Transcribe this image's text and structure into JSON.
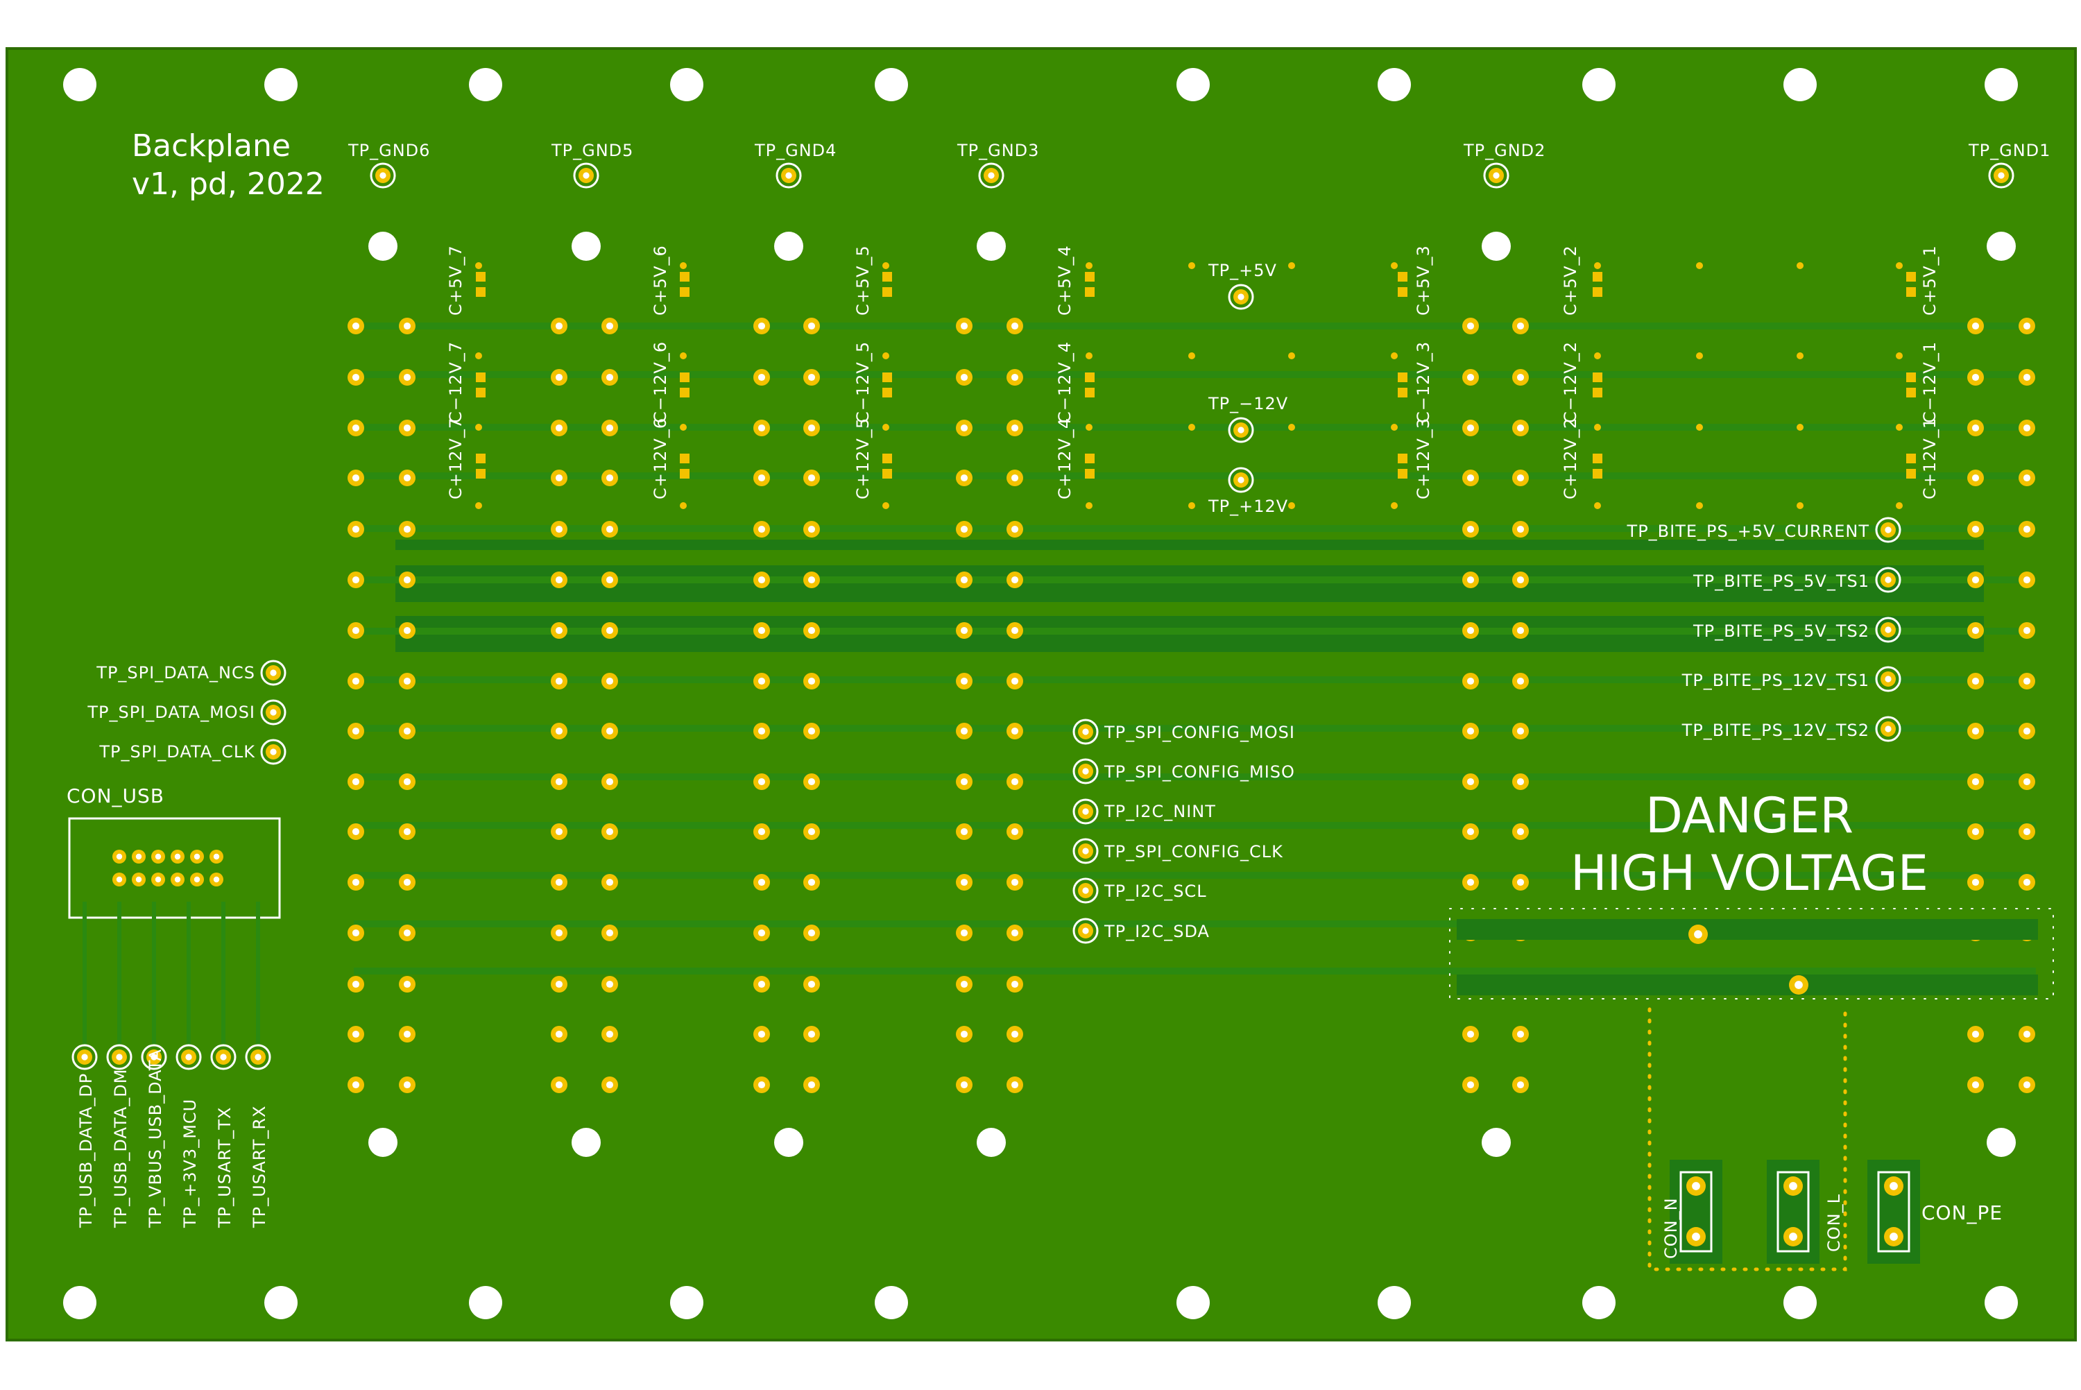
{
  "board": {
    "title_line1": "Backplane",
    "title_line2": "v1, pd, 2022",
    "colors": {
      "board": "#3a8a00",
      "board_edge": "#2d6e00",
      "copper_pour": "#1f7a14",
      "trace": "#2b8a10",
      "pad_gold": "#f2c200",
      "drill": "#ffffff",
      "silkscreen": "#ffffff"
    }
  },
  "gnd_testpoints": [
    "TP_GND6",
    "TP_GND5",
    "TP_GND4",
    "TP_GND3",
    "TP_GND2",
    "TP_GND1"
  ],
  "power_testpoints": {
    "p5v": "TP_+5V",
    "m12v": "TP_−12V",
    "p12v": "TP_+12V"
  },
  "caps": {
    "plus5v": [
      "C+5V_7",
      "C+5V_6",
      "C+5V_5",
      "C+5V_4",
      "C+5V_3",
      "C+5V_2",
      "C+5V_1"
    ],
    "minus12v": [
      "C−12V_7",
      "C−12V_6",
      "C−12V_5",
      "C−12V_4",
      "C−12V_3",
      "C−12V_2",
      "C−12V_1"
    ],
    "plus12v": [
      "C+12V_7",
      "C+12V_6",
      "C+12V_5",
      "C+12V_4",
      "C+12V_3",
      "C+12V_2",
      "C+12V_1"
    ]
  },
  "bite_testpoints": [
    "TP_BITE_PS_+5V_CURRENT",
    "TP_BITE_PS_5V_TS1",
    "TP_BITE_PS_5V_TS2",
    "TP_BITE_PS_12V_TS1",
    "TP_BITE_PS_12V_TS2"
  ],
  "spi_data_testpoints": [
    "TP_SPI_DATA_NCS",
    "TP_SPI_DATA_MOSI",
    "TP_SPI_DATA_CLK"
  ],
  "config_testpoints": [
    "TP_SPI_CONFIG_MOSI",
    "TP_SPI_CONFIG_MISO",
    "TP_I2C_NINT",
    "TP_SPI_CONFIG_CLK",
    "TP_I2C_SCL",
    "TP_I2C_SDA"
  ],
  "usb": {
    "connector_label": "CON_USB",
    "testpoints": [
      "TP_USB_DATA_DP",
      "TP_USB_DATA_DM",
      "TP_VBUS_USB_DATA",
      "TP_+3V3_MCU",
      "TP_USART_TX",
      "TP_USART_RX"
    ]
  },
  "warning": {
    "line1": "DANGER",
    "line2": "HIGH VOLTAGE"
  },
  "mains_connectors": {
    "n": "CON_N",
    "l": "CON_L",
    "pe": "CON_PE"
  }
}
